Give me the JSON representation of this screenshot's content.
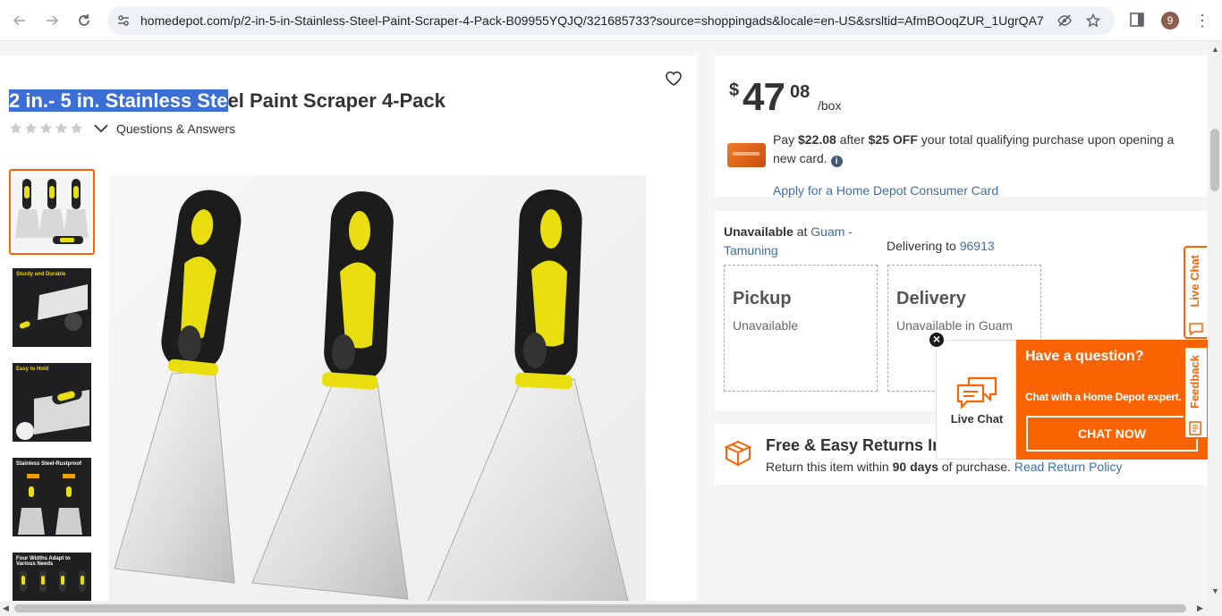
{
  "browser": {
    "url": "homedepot.com/p/2-in-5-in-Stainless-Steel-Paint-Scraper-4-Pack-B09955YQJQ/321685733?source=shoppingads&locale=en-US&srsltid=AfmBOoqZUR_1UgrQA7...",
    "profile_initial": "9"
  },
  "product": {
    "title_selected": "2 in.- 5 in. Stainless Ste",
    "title_rest": "el Paint Scraper 4-Pack",
    "qa_label": "Questions & Answers",
    "rating_stars": 0
  },
  "thumbnails": [
    {
      "caption": ""
    },
    {
      "caption": "Sturdy and Durable"
    },
    {
      "caption": "Easy to Hold"
    },
    {
      "caption": "Stainless Steel-Rustproof"
    },
    {
      "caption": "Four Widths Adapt to Various Needs"
    }
  ],
  "price": {
    "dollar_sign": "$",
    "dollars": "47",
    "cents": "08",
    "unit": "/box"
  },
  "promo": {
    "pay": "Pay",
    "pay_amount": "$22.08",
    "after": "after",
    "off_amount": "$25 OFF",
    "rest": "your total qualifying purchase upon opening a new card.",
    "apply_link": "Apply for a Home Depot Consumer Card"
  },
  "fulfillment": {
    "store_status": "Unavailable",
    "store_at": "at",
    "store_name": "Guam - Tamuning",
    "delivering_to": "Delivering to",
    "zip": "96913",
    "pickup_title": "Pickup",
    "pickup_status": "Unavailable",
    "delivery_title": "Delivery",
    "delivery_status": "Unavailable in Guam"
  },
  "returns": {
    "title": "Free & Easy Returns In",
    "prefix": "Return this item within",
    "days": "90 days",
    "suffix": "of purchase.",
    "link": "Read Return Policy"
  },
  "chat": {
    "live_chat_label": "Live Chat",
    "question": "Have a question?",
    "description": "Chat with a Home Depot expert.",
    "button": "CHAT NOW",
    "close": "×"
  },
  "side_tabs": {
    "live_chat": "Live Chat",
    "feedback": "Feedback"
  },
  "colors": {
    "brand_orange": "#f96302",
    "link_blue": "#3d6ea5",
    "selection_blue": "#3b6fd6"
  }
}
